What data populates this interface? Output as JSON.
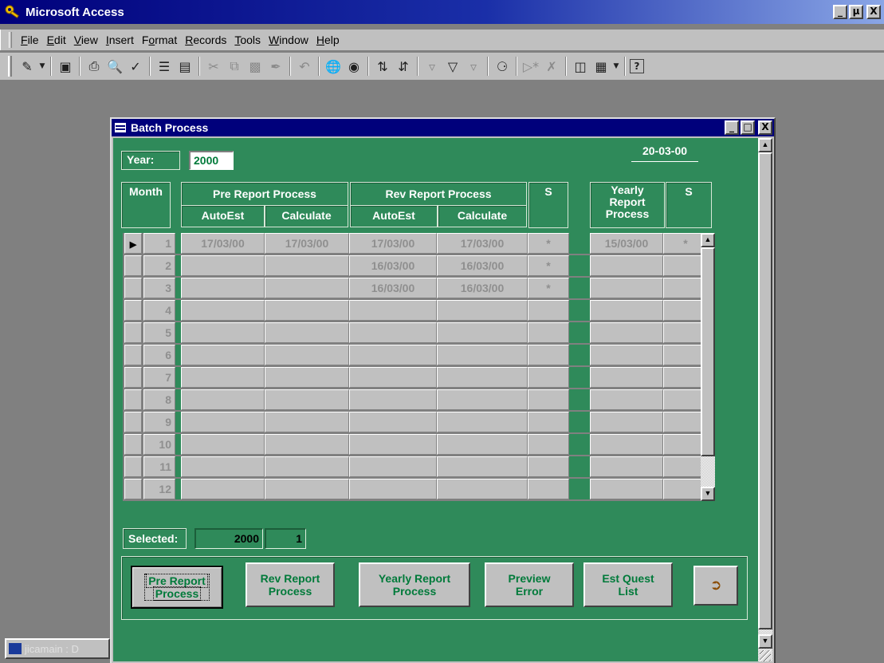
{
  "app": {
    "title": "Microsoft Access",
    "window_buttons": [
      "_",
      "µ",
      "X"
    ]
  },
  "menu": [
    {
      "label": "File",
      "u": "F",
      "rest": "ile"
    },
    {
      "label": "Edit",
      "u": "E",
      "rest": "dit"
    },
    {
      "label": "View",
      "u": "V",
      "rest": "iew"
    },
    {
      "label": "Insert",
      "u": "I",
      "rest": "nsert"
    },
    {
      "label": "Format",
      "pre": "F",
      "u": "o",
      "rest": "rmat"
    },
    {
      "label": "Records",
      "u": "R",
      "rest": "ecords"
    },
    {
      "label": "Tools",
      "u": "T",
      "rest": "ools"
    },
    {
      "label": "Window",
      "u": "W",
      "rest": "indow"
    },
    {
      "label": "Help",
      "u": "H",
      "rest": "elp"
    }
  ],
  "toolbar_icons": [
    "design-view-icon",
    "save-icon",
    "print-icon",
    "print-preview-icon",
    "spelling-icon",
    "format-painter-icon",
    "office-links-icon",
    "cut-icon",
    "copy-icon",
    "paste-icon",
    "format-brush-icon",
    "undo-icon",
    "insert-hyperlink-icon",
    "web-toolbar-icon",
    "sort-ascending-icon",
    "sort-descending-icon",
    "filter-by-selection-icon",
    "filter-by-form-icon",
    "apply-filter-icon",
    "find-icon",
    "new-record-icon",
    "delete-record-icon",
    "database-window-icon",
    "new-object-icon",
    "help-icon"
  ],
  "form": {
    "title": "Batch Process",
    "year_label": "Year:",
    "year_value": "2000",
    "date": "20-03-00",
    "headers": {
      "month": "Month",
      "pre_report": "Pre Report Process",
      "rev_report": "Rev Report Process",
      "s": "S",
      "autoest": "AutoEst",
      "calculate": "Calculate",
      "yearly_1": "Yearly",
      "yearly_2": "Report",
      "yearly_3": "Process",
      "s2": "S"
    },
    "rows": [
      {
        "month": "1",
        "pre_auto": "17/03/00",
        "pre_calc": "17/03/00",
        "rev_auto": "17/03/00",
        "rev_calc": "17/03/00",
        "s": "*",
        "yearly": "15/03/00",
        "s2": "*"
      },
      {
        "month": "2",
        "pre_auto": "",
        "pre_calc": "",
        "rev_auto": "16/03/00",
        "rev_calc": "16/03/00",
        "s": "*",
        "yearly": "",
        "s2": ""
      },
      {
        "month": "3",
        "pre_auto": "",
        "pre_calc": "",
        "rev_auto": "16/03/00",
        "rev_calc": "16/03/00",
        "s": "*",
        "yearly": "",
        "s2": ""
      },
      {
        "month": "4",
        "pre_auto": "",
        "pre_calc": "",
        "rev_auto": "",
        "rev_calc": "",
        "s": "",
        "yearly": "",
        "s2": ""
      },
      {
        "month": "5",
        "pre_auto": "",
        "pre_calc": "",
        "rev_auto": "",
        "rev_calc": "",
        "s": "",
        "yearly": "",
        "s2": ""
      },
      {
        "month": "6",
        "pre_auto": "",
        "pre_calc": "",
        "rev_auto": "",
        "rev_calc": "",
        "s": "",
        "yearly": "",
        "s2": ""
      },
      {
        "month": "7",
        "pre_auto": "",
        "pre_calc": "",
        "rev_auto": "",
        "rev_calc": "",
        "s": "",
        "yearly": "",
        "s2": ""
      },
      {
        "month": "8",
        "pre_auto": "",
        "pre_calc": "",
        "rev_auto": "",
        "rev_calc": "",
        "s": "",
        "yearly": "",
        "s2": ""
      },
      {
        "month": "9",
        "pre_auto": "",
        "pre_calc": "",
        "rev_auto": "",
        "rev_calc": "",
        "s": "",
        "yearly": "",
        "s2": ""
      },
      {
        "month": "10",
        "pre_auto": "",
        "pre_calc": "",
        "rev_auto": "",
        "rev_calc": "",
        "s": "",
        "yearly": "",
        "s2": ""
      },
      {
        "month": "11",
        "pre_auto": "",
        "pre_calc": "",
        "rev_auto": "",
        "rev_calc": "",
        "s": "",
        "yearly": "",
        "s2": ""
      },
      {
        "month": "12",
        "pre_auto": "",
        "pre_calc": "",
        "rev_auto": "",
        "rev_calc": "",
        "s": "",
        "yearly": "",
        "s2": ""
      }
    ],
    "selected_label": "Selected:",
    "selected_year": "2000",
    "selected_month": "1",
    "buttons": {
      "pre_report_1": "Pre Report",
      "pre_report_2": "Process",
      "rev_report_1": "Rev Report",
      "rev_report_2": "Process",
      "yearly_report_1": "Yearly Report",
      "yearly_report_2": "Process",
      "preview_error_1": "Preview",
      "preview_error_2": "Error",
      "est_quest_1": "Est Quest",
      "est_quest_2": "List",
      "exit_icon": "exit-door-icon"
    }
  },
  "taskbar_item": "jicamain : D",
  "colors": {
    "form_background": "#2f8a5a",
    "title_bar": "#00007b",
    "button_text": "#007a3a"
  }
}
